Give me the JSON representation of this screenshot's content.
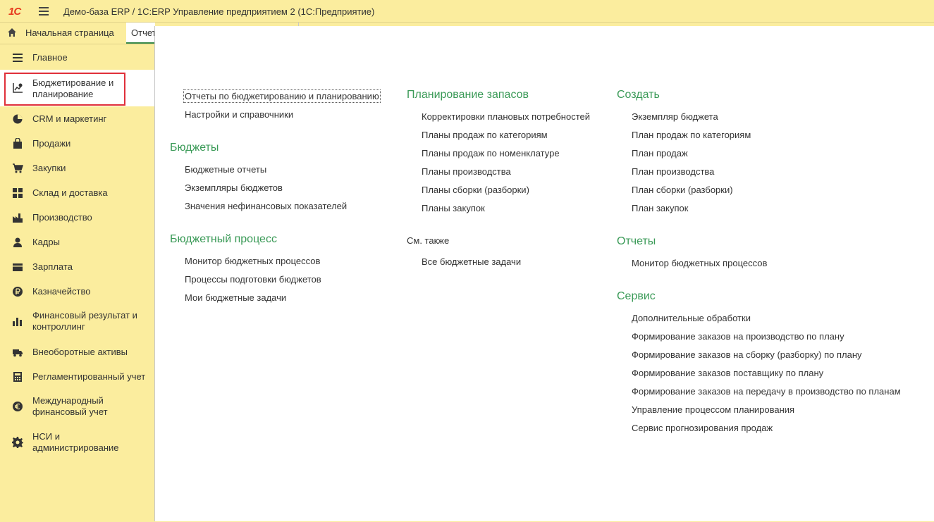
{
  "window": {
    "logo": "1С",
    "title": "Демо-база ERP / 1С:ERP Управление предприятием 2  (1С:Предприятие)"
  },
  "tabs": {
    "home_label": "Начальная страница",
    "reports_label": "Отчеты по бюджетированию и планированию"
  },
  "sidebar": {
    "items": [
      {
        "label": "Главное",
        "icon": "menu-lines-icon"
      },
      {
        "label": "Бюджетирование и планирование",
        "icon": "budget-chart-icon",
        "active": true
      },
      {
        "label": "CRM и маркетинг",
        "icon": "pie-chart-icon"
      },
      {
        "label": "Продажи",
        "icon": "shopping-bag-icon"
      },
      {
        "label": "Закупки",
        "icon": "cart-icon"
      },
      {
        "label": "Склад и доставка",
        "icon": "warehouse-grid-icon"
      },
      {
        "label": "Производство",
        "icon": "factory-icon"
      },
      {
        "label": "Кадры",
        "icon": "person-icon"
      },
      {
        "label": "Зарплата",
        "icon": "wallet-icon"
      },
      {
        "label": "Казначейство",
        "icon": "ruble-coin-icon"
      },
      {
        "label": "Финансовый результат и контроллинг",
        "icon": "bar-chart-icon"
      },
      {
        "label": "Внеоборотные активы",
        "icon": "truck-icon"
      },
      {
        "label": "Регламентированный учет",
        "icon": "calculator-icon"
      },
      {
        "label": "Международный финансовый учет",
        "icon": "euro-icon"
      },
      {
        "label": "НСИ и администрирование",
        "icon": "gear-icon"
      }
    ]
  },
  "content": {
    "col1": {
      "top_links": [
        "Отчеты по бюджетированию и планированию",
        "Настройки и справочники"
      ],
      "budgets": {
        "title": "Бюджеты",
        "items": [
          "Бюджетные отчеты",
          "Экземпляры бюджетов",
          "Значения нефинансовых показателей"
        ]
      },
      "process": {
        "title": "Бюджетный процесс",
        "items": [
          "Монитор бюджетных процессов",
          "Процессы подготовки бюджетов",
          "Мои бюджетные задачи"
        ]
      }
    },
    "col2": {
      "stock": {
        "title": "Планирование запасов",
        "items": [
          "Корректировки плановых потребностей",
          "Планы продаж по категориям",
          "Планы продаж по номенклатуре",
          "Планы производства",
          "Планы сборки (разборки)",
          "Планы закупок"
        ]
      },
      "see_also": {
        "title": "См. также",
        "items": [
          "Все бюджетные задачи"
        ]
      }
    },
    "col3": {
      "create": {
        "title": "Создать",
        "items": [
          "Экземпляр бюджета",
          "План продаж по категориям",
          "План продаж",
          "План производства",
          "План сборки (разборки)",
          "План закупок"
        ]
      },
      "reports": {
        "title": "Отчеты",
        "items": [
          "Монитор бюджетных процессов"
        ]
      },
      "service": {
        "title": "Сервис",
        "items": [
          "Дополнительные обработки",
          "Формирование заказов на производство по плану",
          "Формирование заказов на сборку (разборку) по плану",
          "Формирование заказов поставщику по плану",
          "Формирование заказов на передачу в производство по планам",
          "Управление процессом планирования",
          "Сервис прогнозирования продаж"
        ]
      }
    }
  }
}
